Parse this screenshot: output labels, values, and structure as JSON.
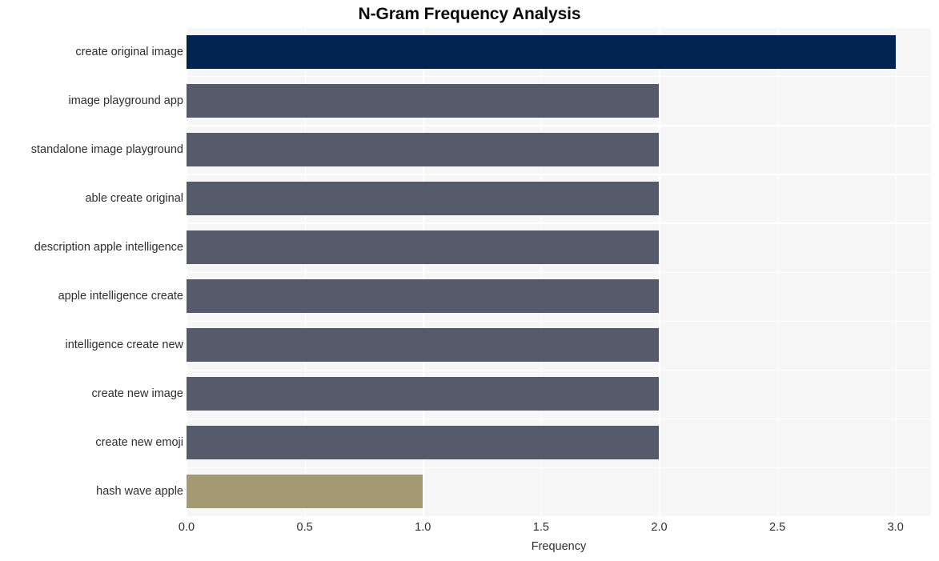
{
  "chart_data": {
    "type": "bar",
    "orientation": "horizontal",
    "title": "N-Gram Frequency Analysis",
    "xlabel": "Frequency",
    "ylabel": "",
    "categories": [
      "create original image",
      "image playground app",
      "standalone image playground",
      "able create original",
      "description apple intelligence",
      "apple intelligence create",
      "intelligence create new",
      "create new image",
      "create new emoji",
      "hash wave apple"
    ],
    "values": [
      3,
      2,
      2,
      2,
      2,
      2,
      2,
      2,
      2,
      1
    ],
    "bar_colors": [
      "#01234f",
      "#555b6b",
      "#555b6b",
      "#555b6b",
      "#555b6b",
      "#555b6b",
      "#555b6b",
      "#555b6b",
      "#555b6b",
      "#a39a74"
    ],
    "xlim": [
      0.0,
      3.15
    ],
    "xticks": [
      0.0,
      0.5,
      1.0,
      1.5,
      2.0,
      2.5,
      3.0
    ],
    "xtick_labels": [
      "0.0",
      "0.5",
      "1.0",
      "1.5",
      "2.0",
      "2.5",
      "3.0"
    ],
    "grid": true,
    "grid_color": "#ffffff",
    "plot_background": "#f6f6f7",
    "figure_background": "#ffffff",
    "legend": null
  }
}
